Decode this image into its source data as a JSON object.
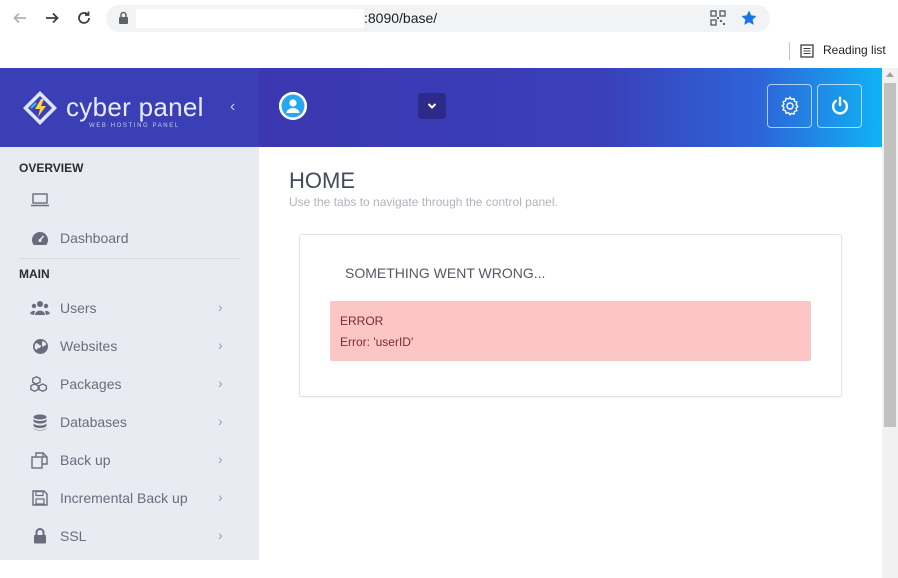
{
  "browser": {
    "url_visible": ":8090/base/",
    "reading_list_label": "Reading list"
  },
  "header": {
    "logo_text": "cyber panel",
    "logo_subtitle": "WEB HOSTING PANEL",
    "collapse_glyph": "‹"
  },
  "sidebar": {
    "sections": [
      {
        "heading": "OVERVIEW"
      },
      {
        "heading": "MAIN"
      }
    ],
    "overview_items": [
      {
        "label": "",
        "icon": "laptop-icon"
      },
      {
        "label": "Dashboard",
        "icon": "dashboard-icon"
      }
    ],
    "main_items": [
      {
        "label": "Users",
        "icon": "users-icon"
      },
      {
        "label": "Websites",
        "icon": "globe-icon"
      },
      {
        "label": "Packages",
        "icon": "packages-icon"
      },
      {
        "label": "Databases",
        "icon": "database-icon"
      },
      {
        "label": "Back up",
        "icon": "backup-icon"
      },
      {
        "label": "Incremental Back up",
        "icon": "save-icon"
      },
      {
        "label": "SSL",
        "icon": "lock-icon"
      }
    ],
    "chevron": "›"
  },
  "main": {
    "title": "HOME",
    "subtitle": "Use the tabs to navigate through the control panel.",
    "panel_title": "SOMETHING WENT WRONG...",
    "alert_title": "ERROR",
    "alert_message": "Error: 'userID'"
  },
  "colors": {
    "header_left": "#3a3fb5",
    "header_gradient_end": "#0fb3f5",
    "sidebar_bg": "#e9ebf2",
    "alert_bg": "#fdc6c6",
    "bookmark_star": "#1a73e8"
  }
}
